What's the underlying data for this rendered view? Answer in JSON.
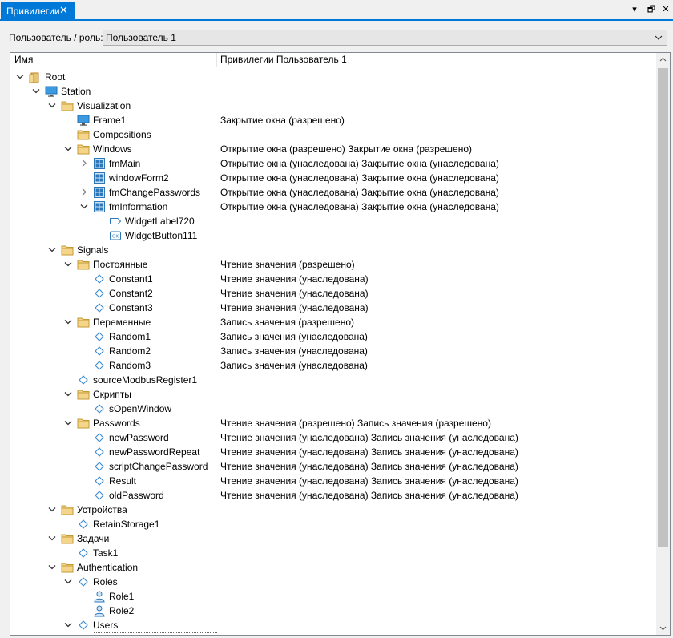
{
  "tab": {
    "title": "Привилегии",
    "close": "✕"
  },
  "window_controls": {
    "menu": "▾",
    "restore": "🗗",
    "close": "✕"
  },
  "user_selector": {
    "label": "Пользователь / роль:",
    "value": "Пользователь 1"
  },
  "tree": {
    "columns": {
      "name": "Имя",
      "privileges": "Привилегии Пользователь 1"
    },
    "rows": [
      {
        "depth": 0,
        "toggle": "expanded",
        "icon": "root-icon",
        "label": "Root",
        "priv": ""
      },
      {
        "depth": 1,
        "toggle": "expanded",
        "icon": "monitor-icon",
        "label": "Station",
        "priv": ""
      },
      {
        "depth": 2,
        "toggle": "expanded",
        "icon": "folder-icon",
        "label": "Visualization",
        "priv": ""
      },
      {
        "depth": 3,
        "toggle": "none",
        "icon": "monitor-icon",
        "label": "Frame1",
        "priv": "Закрытие окна (разрешено)"
      },
      {
        "depth": 3,
        "toggle": "none",
        "icon": "folder-icon",
        "label": "Compositions",
        "priv": ""
      },
      {
        "depth": 3,
        "toggle": "expanded",
        "icon": "folder-icon",
        "label": "Windows",
        "priv": "Открытие окна (разрешено) Закрытие окна (разрешено)"
      },
      {
        "depth": 4,
        "toggle": "collapsed",
        "icon": "window-icon",
        "label": "fmMain",
        "priv": "Открытие окна (унаследована) Закрытие окна (унаследована)"
      },
      {
        "depth": 4,
        "toggle": "none",
        "icon": "window-icon",
        "label": "windowForm2",
        "priv": "Открытие окна (унаследована) Закрытие окна (унаследована)"
      },
      {
        "depth": 4,
        "toggle": "collapsed",
        "icon": "window-icon",
        "label": "fmChangePasswords",
        "priv": "Открытие окна (унаследована) Закрытие окна (унаследована)"
      },
      {
        "depth": 4,
        "toggle": "expanded",
        "icon": "window-icon",
        "label": "fmInformation",
        "priv": "Открытие окна (унаследована) Закрытие окна (унаследована)"
      },
      {
        "depth": 5,
        "toggle": "none",
        "icon": "label-widget-icon",
        "label": "WidgetLabel720",
        "priv": ""
      },
      {
        "depth": 5,
        "toggle": "none",
        "icon": "button-widget-icon",
        "label": "WidgetButton111",
        "priv": ""
      },
      {
        "depth": 2,
        "toggle": "expanded",
        "icon": "folder-icon",
        "label": "Signals",
        "priv": ""
      },
      {
        "depth": 3,
        "toggle": "expanded",
        "icon": "folder-icon",
        "label": "Постоянные",
        "priv": "Чтение значения (разрешено)"
      },
      {
        "depth": 4,
        "toggle": "none",
        "icon": "signal-icon",
        "label": "Constant1",
        "priv": "Чтение значения (унаследована)"
      },
      {
        "depth": 4,
        "toggle": "none",
        "icon": "signal-icon",
        "label": "Constant2",
        "priv": "Чтение значения (унаследована)"
      },
      {
        "depth": 4,
        "toggle": "none",
        "icon": "signal-icon",
        "label": "Constant3",
        "priv": "Чтение значения (унаследована)"
      },
      {
        "depth": 3,
        "toggle": "expanded",
        "icon": "folder-icon",
        "label": "Переменные",
        "priv": "Запись значения (разрешено)"
      },
      {
        "depth": 4,
        "toggle": "none",
        "icon": "signal-icon",
        "label": "Random1",
        "priv": "Запись значения (унаследована)"
      },
      {
        "depth": 4,
        "toggle": "none",
        "icon": "signal-icon",
        "label": "Random2",
        "priv": "Запись значения (унаследована)"
      },
      {
        "depth": 4,
        "toggle": "none",
        "icon": "signal-icon",
        "label": "Random3",
        "priv": "Запись значения (унаследована)"
      },
      {
        "depth": 3,
        "toggle": "none",
        "icon": "signal-icon",
        "label": "sourceModbusRegister1",
        "priv": ""
      },
      {
        "depth": 3,
        "toggle": "expanded",
        "icon": "folder-icon",
        "label": "Скрипты",
        "priv": ""
      },
      {
        "depth": 4,
        "toggle": "none",
        "icon": "signal-icon",
        "label": "sOpenWindow",
        "priv": ""
      },
      {
        "depth": 3,
        "toggle": "expanded",
        "icon": "folder-icon",
        "label": "Passwords",
        "priv": "Чтение значения (разрешено) Запись значения (разрешено)"
      },
      {
        "depth": 4,
        "toggle": "none",
        "icon": "signal-icon",
        "label": "newPassword",
        "priv": "Чтение значения (унаследована) Запись значения (унаследована)"
      },
      {
        "depth": 4,
        "toggle": "none",
        "icon": "signal-icon",
        "label": "newPasswordRepeat",
        "priv": "Чтение значения (унаследована) Запись значения (унаследована)"
      },
      {
        "depth": 4,
        "toggle": "none",
        "icon": "signal-icon",
        "label": "scriptChangePassword",
        "priv": "Чтение значения (унаследована) Запись значения (унаследована)"
      },
      {
        "depth": 4,
        "toggle": "none",
        "icon": "signal-icon",
        "label": "Result",
        "priv": "Чтение значения (унаследована) Запись значения (унаследована)"
      },
      {
        "depth": 4,
        "toggle": "none",
        "icon": "signal-icon",
        "label": "oldPassword",
        "priv": "Чтение значения (унаследована) Запись значения (унаследована)"
      },
      {
        "depth": 2,
        "toggle": "expanded",
        "icon": "folder-icon",
        "label": "Устройства",
        "priv": ""
      },
      {
        "depth": 3,
        "toggle": "none",
        "icon": "signal-icon",
        "label": "RetainStorage1",
        "priv": ""
      },
      {
        "depth": 2,
        "toggle": "expanded",
        "icon": "folder-icon",
        "label": "Задачи",
        "priv": ""
      },
      {
        "depth": 3,
        "toggle": "none",
        "icon": "signal-icon",
        "label": "Task1",
        "priv": ""
      },
      {
        "depth": 2,
        "toggle": "expanded",
        "icon": "folder-icon",
        "label": "Authentication",
        "priv": ""
      },
      {
        "depth": 3,
        "toggle": "expanded",
        "icon": "signal-icon",
        "label": "Roles",
        "priv": ""
      },
      {
        "depth": 4,
        "toggle": "none",
        "icon": "user-icon",
        "label": "Role1",
        "priv": ""
      },
      {
        "depth": 4,
        "toggle": "none",
        "icon": "user-icon",
        "label": "Role2",
        "priv": ""
      },
      {
        "depth": 3,
        "toggle": "expanded",
        "icon": "signal-icon",
        "label": "Users",
        "priv": ""
      }
    ]
  }
}
